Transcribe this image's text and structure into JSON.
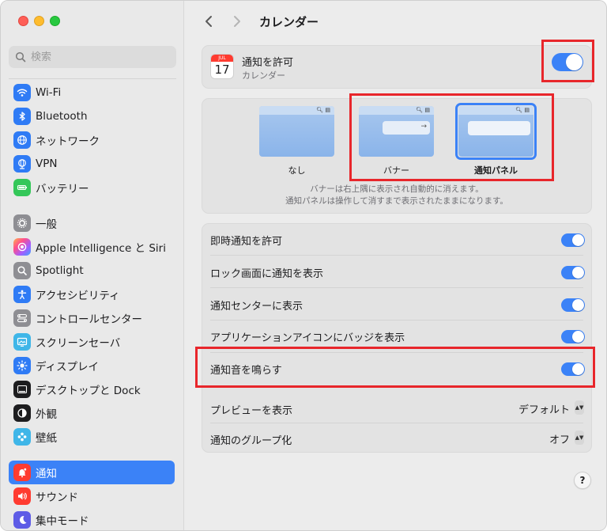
{
  "sidebar": {
    "search_placeholder": "検索",
    "items": [
      {
        "label": "Wi-Fi",
        "icon": "wifi-icon",
        "color": "#2f7bf5"
      },
      {
        "label": "Bluetooth",
        "icon": "bluetooth-icon",
        "color": "#2f7bf5"
      },
      {
        "label": "ネットワーク",
        "icon": "globe-icon",
        "color": "#2f7bf5"
      },
      {
        "label": "VPN",
        "icon": "vpn-globe-icon",
        "color": "#2f7bf5"
      },
      {
        "label": "バッテリー",
        "icon": "battery-icon",
        "color": "#34c759"
      },
      {
        "label": "一般",
        "icon": "gear-icon",
        "color": "#8e8e93"
      },
      {
        "label": "Apple Intelligence と Siri",
        "icon": "siri-icon",
        "color": "#ff6a8f"
      },
      {
        "label": "Spotlight",
        "icon": "magnifier-icon",
        "color": "#8e8e93"
      },
      {
        "label": "アクセシビリティ",
        "icon": "accessibility-icon",
        "color": "#2f7bf5"
      },
      {
        "label": "コントロールセンター",
        "icon": "control-center-icon",
        "color": "#8e8e93"
      },
      {
        "label": "スクリーンセーバ",
        "icon": "screensaver-icon",
        "color": "#3fb6e8"
      },
      {
        "label": "ディスプレイ",
        "icon": "sun-icon",
        "color": "#2f7bf5"
      },
      {
        "label": "デスクトップと Dock",
        "icon": "dock-icon",
        "color": "#1d1d1f"
      },
      {
        "label": "外観",
        "icon": "appearance-icon",
        "color": "#1d1d1f"
      },
      {
        "label": "壁紙",
        "icon": "wallpaper-icon",
        "color": "#3fb6e8"
      },
      {
        "label": "通知",
        "icon": "bell-icon",
        "color": "#ff3b30"
      },
      {
        "label": "サウンド",
        "icon": "speaker-icon",
        "color": "#ff3b30"
      },
      {
        "label": "集中モード",
        "icon": "moon-icon",
        "color": "#5e5ce6"
      }
    ],
    "active_index": 15
  },
  "header": {
    "back_icon": "chevron-left-icon",
    "forward_icon": "chevron-right-icon",
    "title": "カレンダー"
  },
  "app_card": {
    "calendar_month": "JUL",
    "calendar_day": "17",
    "title": "通知を許可",
    "subtitle": "カレンダー",
    "enabled": true
  },
  "style_picker": {
    "options": [
      {
        "label": "なし",
        "selected": false
      },
      {
        "label": "バナー",
        "selected": false
      },
      {
        "label": "通知パネル",
        "selected": true
      }
    ],
    "description_line1": "バナーは右上隅に表示され自動的に消えます。",
    "description_line2": "通知パネルは操作して消すまで表示されたままになります。"
  },
  "toggles": [
    {
      "label": "即時通知を許可",
      "on": true
    },
    {
      "label": "ロック画面に通知を表示",
      "on": true
    },
    {
      "label": "通知センターに表示",
      "on": true
    },
    {
      "label": "アプリケーションアイコンにバッジを表示",
      "on": true
    },
    {
      "label": "通知音を鳴らす",
      "on": true
    }
  ],
  "selects": [
    {
      "label": "プレビューを表示",
      "value": "デフォルト"
    },
    {
      "label": "通知のグループ化",
      "value": "オフ"
    }
  ],
  "help_label": "?",
  "colors": {
    "accent": "#3b82f7",
    "highlight_box": "#e8262b"
  }
}
